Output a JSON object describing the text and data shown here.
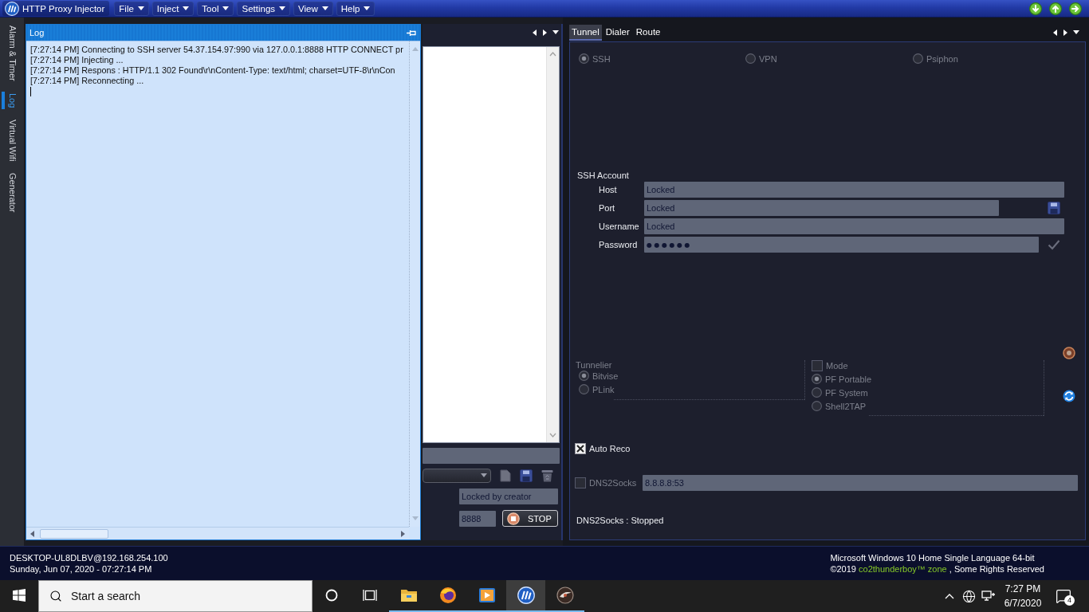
{
  "title_bar": {
    "title": "HTTP Proxy Injector",
    "menus": [
      {
        "label": "File"
      },
      {
        "label": "Inject"
      },
      {
        "label": "Tool"
      },
      {
        "label": "Settings"
      },
      {
        "label": "View"
      },
      {
        "label": "Help"
      }
    ]
  },
  "side_tabs": [
    {
      "label": "Alarm & Timer",
      "selected": false
    },
    {
      "label": "Log",
      "selected": true
    },
    {
      "label": "Virtual Wifi",
      "selected": false
    },
    {
      "label": "Generator",
      "selected": false
    }
  ],
  "log_panel": {
    "title": "Log",
    "lines": [
      "[7:27:14 PM] Connecting to SSH server 54.37.154.97:990 via 127.0.0.1:8888 HTTP CONNECT pr",
      "[7:27:14 PM] Injecting ...",
      "[7:27:14 PM] Respons : HTTP/1.1 302 Found\\r\\nContent-Type: text/html; charset=UTF-8\\r\\nCon",
      "[7:27:14 PM] Reconnecting ..."
    ]
  },
  "injector_panel": {
    "status_field": "Locked by creator",
    "port_field": "8888",
    "stop_button": "STOP"
  },
  "tunnel_panel": {
    "tabs": [
      {
        "label": "Tunnel",
        "selected": true
      },
      {
        "label": "Dialer",
        "selected": false
      },
      {
        "label": "Route",
        "selected": false
      }
    ],
    "modes": [
      {
        "label": "SSH",
        "selected": true,
        "disabled": true
      },
      {
        "label": "VPN",
        "selected": false,
        "disabled": true
      },
      {
        "label": "Psiphon",
        "selected": false,
        "disabled": true
      }
    ],
    "ssh_account": {
      "title": "SSH Account",
      "fields": [
        {
          "label": "Host",
          "value": "Locked",
          "kind": "text"
        },
        {
          "label": "Port",
          "value": "Locked",
          "kind": "text"
        },
        {
          "label": "Username",
          "value": "Locked",
          "kind": "text"
        },
        {
          "label": "Password",
          "value": "●●●●●●",
          "kind": "password"
        }
      ]
    },
    "tunnelier": {
      "title": "Tunnelier",
      "options": [
        {
          "label": "Bitvise",
          "selected": true,
          "disabled": true
        },
        {
          "label": "PLink",
          "selected": false,
          "disabled": true
        }
      ]
    },
    "mode": {
      "label": "Mode",
      "checked": false,
      "disabled": true,
      "options": [
        {
          "label": "PF Portable",
          "selected": true,
          "disabled": true
        },
        {
          "label": "PF System",
          "selected": false,
          "disabled": true
        },
        {
          "label": "Shell2TAP",
          "selected": false,
          "disabled": true
        }
      ]
    },
    "auto_reco": {
      "label": "Auto Reco",
      "checked": true,
      "disabled": false
    },
    "dns2socks": {
      "label": "DNS2Socks",
      "checked": false,
      "disabled": true,
      "value": "8.8.8.8:53"
    },
    "status": "DNS2Socks : Stopped"
  },
  "status_strip": {
    "host": "DESKTOP-UL8DLBV@192.168.254.100",
    "datetime": "Sunday, Jun 07, 2020 - 07:27:14 PM",
    "os": "Microsoft Windows 10 Home Single Language 64-bit",
    "copyright": {
      "before": "©2019 ",
      "highlight": "co2thunderboy™ zone",
      "after": " , Some Rights Reserved"
    }
  },
  "taskbar": {
    "search_placeholder": "Start a search",
    "apps": [
      {
        "kind": "folder",
        "selected": false,
        "running": true
      },
      {
        "kind": "browser",
        "selected": false,
        "running": true
      },
      {
        "kind": "media",
        "selected": false,
        "running": true
      },
      {
        "kind": "proxy",
        "selected": true,
        "running": true
      },
      {
        "kind": "disc",
        "selected": false,
        "running": true
      }
    ],
    "time": "7:27 PM",
    "date": "6/7/2020",
    "notification_count": "4"
  }
}
